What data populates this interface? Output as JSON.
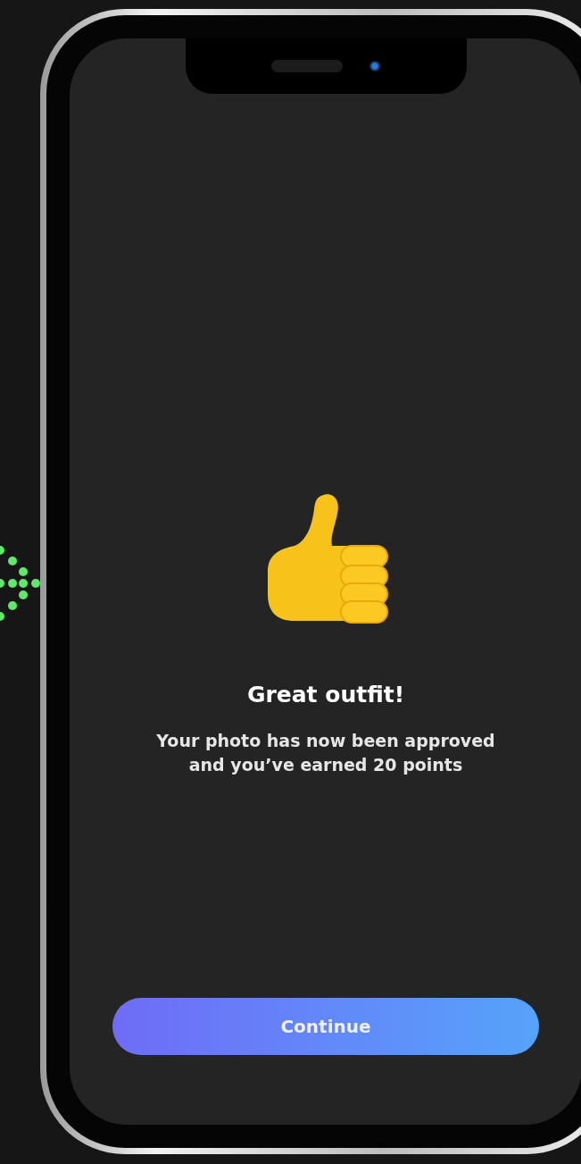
{
  "screen": {
    "title": "Great outfit!",
    "message": "Your photo has now been approved and you’ve earned 20 points",
    "button": "Continue"
  }
}
